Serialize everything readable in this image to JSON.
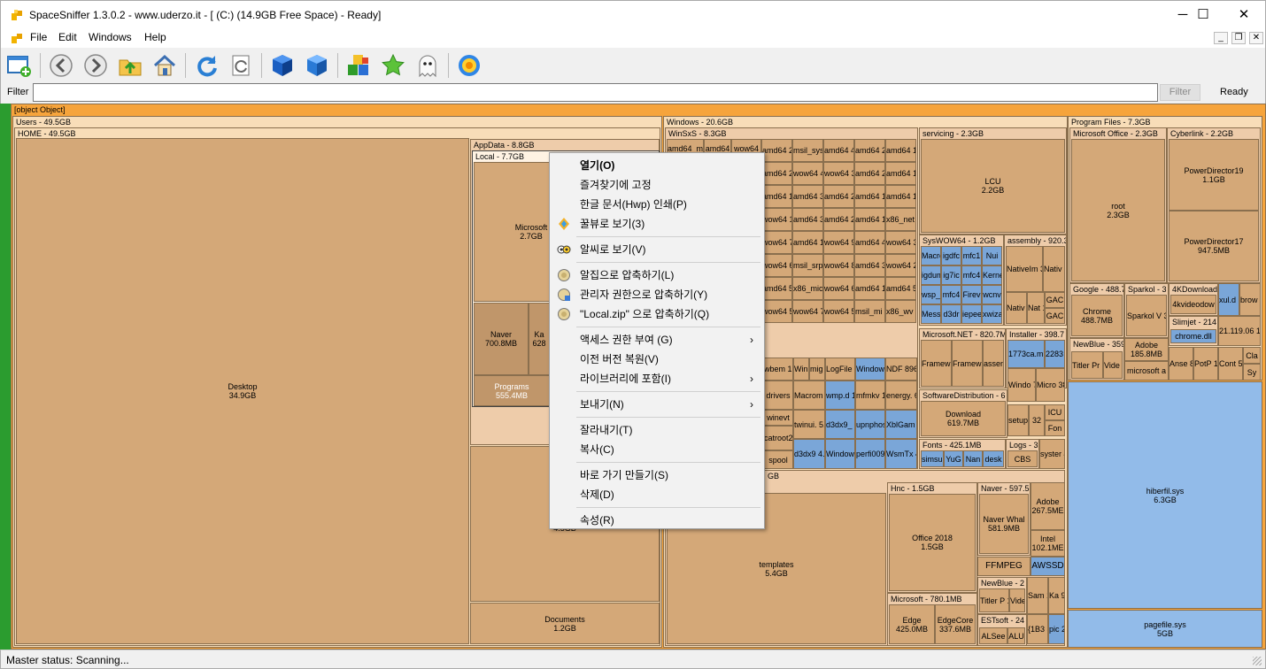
{
  "window": {
    "title": "SpaceSniffer 1.3.0.2 - www.uderzo.it - [ (C:) (14.9GB Free Space) - Ready]",
    "icon": "app-puzzle-icon",
    "minimize": "─",
    "maximize": "☐",
    "close": "✕"
  },
  "menu": {
    "items": [
      "File",
      "Edit",
      "Windows",
      "Help"
    ],
    "mdi_min": "_",
    "mdi_restore": "❐",
    "mdi_close": "✕"
  },
  "toolbar": {
    "icons": [
      "new-view-icon",
      "back-icon",
      "forward-icon",
      "folder-up-icon",
      "home-icon",
      "refresh-icon",
      "refresh-all-icon",
      "cube-icon",
      "cube-blue-icon",
      "blocks-icon",
      "star-icon",
      "ghost-icon",
      "settings-flower-icon"
    ]
  },
  "filter": {
    "label": "Filter",
    "value": "",
    "button": "Filter",
    "status": "Ready"
  },
  "treemap": {
    "root": {
      "name": "root",
      "size": "2.3GB"
    },
    "users": "Users - 49.5GB",
    "home": "HOME - 49.5GB",
    "desktop": {
      "name": "Desktop",
      "size": "34.9GB"
    },
    "appdata": "AppData - 8.8GB",
    "local": "Local - 7.7GB",
    "microsoft_local": {
      "name": "Microsoft",
      "size": "2.7GB"
    },
    "naver_local": {
      "name": "Naver",
      "size": "700.8MB"
    },
    "ka_local": {
      "name": "Ka",
      "size": "628"
    },
    "programs_local": {
      "name": "Programs",
      "size": "555.4MB"
    },
    "d_local": {
      "name": "D",
      "size": "4.5GB"
    },
    "documents": {
      "name": "Documents",
      "size": "1.2GB"
    },
    "windows": "Windows - 20.6GB",
    "winsxs": "WinSxS - 8.3GB",
    "winsxs_cells": [
      "amd64_m",
      "amd64",
      "wow64",
      "amd64 22.6MB",
      "msil_sys 4.8MB",
      "amd64 4.0MB",
      "amd64 2.3MB",
      "amd64 1.9MB",
      "amd64 22.0MB",
      "wow64 4.6MB",
      "wow64 3.7MB",
      "amd64 2.1MB",
      "amd64 1.7MB",
      "amd64 18.7MB",
      "amd64 3.5MB",
      "amd64 2.8MB",
      "amd64 1.6MB",
      "amd64 1.3MB",
      "wow64 17.9MB",
      "amd64 3.1MB",
      "amd64 2.6MB",
      "amd64 1.4MB",
      "x86_net 1.2MB",
      "wow64 7.2MB",
      "amd64 1.1MB",
      "wow64 960KB",
      "amd64 440KB",
      "wow64 300KB",
      "wow64 6.8MB",
      "msil_srp 1.0MB",
      "wow64 860KB",
      "amd64 368KB",
      "wow64 232KB",
      "amd64 5.4MB",
      "x86_mic 784KB",
      "wow64 604KB",
      "amd64 168KB",
      "amd64 56KB",
      "wow64 5.1MB",
      "wow64 700KB",
      "wow64 520KB",
      "msil_mi 112KB",
      "x86_wv 4KB"
    ],
    "servicing": "servicing - 2.3GB",
    "lcu": {
      "name": "LCU",
      "size": "2.2GB"
    },
    "syswow": "SysWOW64 - 1.2GB",
    "syswow_cells": [
      "Macro",
      "igdfc",
      "mfc1",
      "Nui",
      "igdum",
      "ig7ic",
      "mfc4",
      "Kerne",
      "wsp_",
      "mfc4",
      "Firev",
      "wcnv",
      "Messa",
      "d3dr",
      "iepee",
      "xwiza"
    ],
    "assembly": "assembly - 920.3",
    "assembly_cells": [
      "NativeIm 323.5MB",
      "Nativ 185.8",
      "Nativ 160.2",
      "Nat 107",
      "GAC",
      "GAC"
    ],
    "misc_cells": [
      "wbem 164.8M",
      "Win 49.1",
      "mig 44.9",
      "LogFile 13.9MB",
      "Window 1.7MB",
      "NDF 896KB",
      "drivers",
      "Macrom 29.5MB",
      "wmp.d 10.9MB",
      "mfmkv 1.1MB",
      "energy. 656KB",
      "winevt",
      "twinui. 5.9MB",
      "d3dx9_ 3.5MB",
      "upnphos 464KB",
      "XblGam 156KB",
      "catroot2 59.3MB",
      "spool",
      "d3dx9 4.1MB",
      "Window 2.2MB",
      "perfi009 292KB",
      "WsmTx 4KB"
    ],
    "msnet": "Microsoft.NET - 820.7M",
    "msnet_cells": [
      "Framew 313.5M",
      "Framew 288.8M",
      "assem 189.8"
    ],
    "installer": "Installer - 398.7",
    "installer_cells": [
      "1773ca.m 179.1MB",
      "2283 65.0",
      "Windo 76KB",
      "Micro 380KB"
    ],
    "softdist": "SoftwareDistribution - 6",
    "download": {
      "name": "Download",
      "size": "619.7MB"
    },
    "setup": "setup 33.6",
    "c32": "32",
    "icu": "ICU",
    "fonts_small": "Fon",
    "fonts": "Fonts - 425.1MB",
    "fonts_cells": [
      "simsun",
      "YuG",
      "Nan",
      "desk"
    ],
    "logs": "Logs - 3",
    "cbs": "CBS",
    "system": "syster 4.6MB",
    "gb_label": "GB",
    "templates": {
      "name": "templates",
      "size": "5.4GB"
    },
    "hnc": "Hnc - 1.5GB",
    "office2018": {
      "name": "Office 2018",
      "size": "1.5GB"
    },
    "microsoft2": "Microsoft - 780.1MB",
    "edge": {
      "name": "Edge",
      "size": "425.0MB"
    },
    "edgecore": {
      "name": "EdgeCore",
      "size": "337.6MB"
    },
    "naver2": "Naver - 597.5",
    "naverwhale": {
      "name": "Naver Whal",
      "size": "581.9MB"
    },
    "ffmpeg": "FFMPEG",
    "adobe": {
      "name": "Adobe",
      "size": "267.5ME"
    },
    "intel": {
      "name": "Intel",
      "size": "102.1ME"
    },
    "awssd": "AWSSD",
    "newblue2": "NewBlue - 2",
    "titlerp": "Titler P 127.2M",
    "vide2": "Vide 52.3",
    "sam": "Sam 135.",
    "ka2": "Ka 98.",
    "estsoft": "ESTsoft - 24",
    "alsee": "ALSee",
    "alu": "ALU",
    "x1": "{1B3 3.5M",
    "pic": "pic 2.2M",
    "progfiles": "Program Files - 7.3GB",
    "msoffice": "Microsoft Office - 2.3GB",
    "cyberlink": "Cyberlink - 2.2GB",
    "pd19": {
      "name": "PowerDirector19",
      "size": "1.1GB"
    },
    "pd17": {
      "name": "PowerDirector17",
      "size": "947.5MB"
    },
    "google": "Google - 488.7",
    "chrome": {
      "name": "Chrome",
      "size": "488.7MB"
    },
    "sparkol": "Sparkol - 3",
    "sparkolv": "Sparkol V 340.4MB",
    "kdl": "4KDownload",
    "kvideo": "4kvideodow",
    "xul": "xul.d 110.",
    "brow": "brow 48.2",
    "slimjet": "Slimjet - 214",
    "chromedll": "chrome.dll",
    "v21": "21.119.06 179.6MB",
    "newblue": "NewBlue - 359",
    "titlerpr": "Titler Pr 140.1MI",
    "video": "Vide 67.5l",
    "adobe2": {
      "name": "Adobe",
      "size": "185.8MB"
    },
    "msa": "microsoft a",
    "anse": "Anse 82.6l",
    "potp": "PotP 101.2",
    "cont": "Cont 50.3l",
    "cla": "Cla",
    "sy": "Sy",
    "hiberfil": {
      "name": "hiberfil.sys",
      "size": "6.3GB"
    },
    "pagefile": {
      "name": "pagefile.sys",
      "size": "5GB"
    }
  },
  "context_menu": [
    {
      "label": "열기(O)",
      "bold": true,
      "icon": ""
    },
    {
      "label": "즐겨찾기에 고정",
      "icon": ""
    },
    {
      "label": "한글 문서(Hwp) 인쇄(P)",
      "icon": ""
    },
    {
      "label": "꿀뷰로 보기(3)",
      "icon": "honeyview-icon"
    },
    {
      "sep": true
    },
    {
      "label": "알씨로 보기(V)",
      "icon": "alsee-icon"
    },
    {
      "sep": true
    },
    {
      "label": "알집으로 압축하기(L)",
      "icon": "alzip-icon"
    },
    {
      "label": "관리자 권한으로 압축하기(Y)",
      "icon": "alzip-admin-icon"
    },
    {
      "label": "\"Local.zip\" 으로 압축하기(Q)",
      "icon": "alzip-icon"
    },
    {
      "sep": true
    },
    {
      "label": "액세스 권한 부여 (G)",
      "arrow": true
    },
    {
      "label": "이전 버전 복원(V)"
    },
    {
      "label": "라이브러리에 포함(I)",
      "arrow": true
    },
    {
      "sep": true
    },
    {
      "label": "보내기(N)",
      "arrow": true
    },
    {
      "sep": true
    },
    {
      "label": "잘라내기(T)"
    },
    {
      "label": "복사(C)"
    },
    {
      "sep": true
    },
    {
      "label": "바로 가기 만들기(S)"
    },
    {
      "label": "삭제(D)"
    },
    {
      "sep": true
    },
    {
      "label": "속성(R)"
    }
  ],
  "status": {
    "text": "Master status: Scanning..."
  }
}
